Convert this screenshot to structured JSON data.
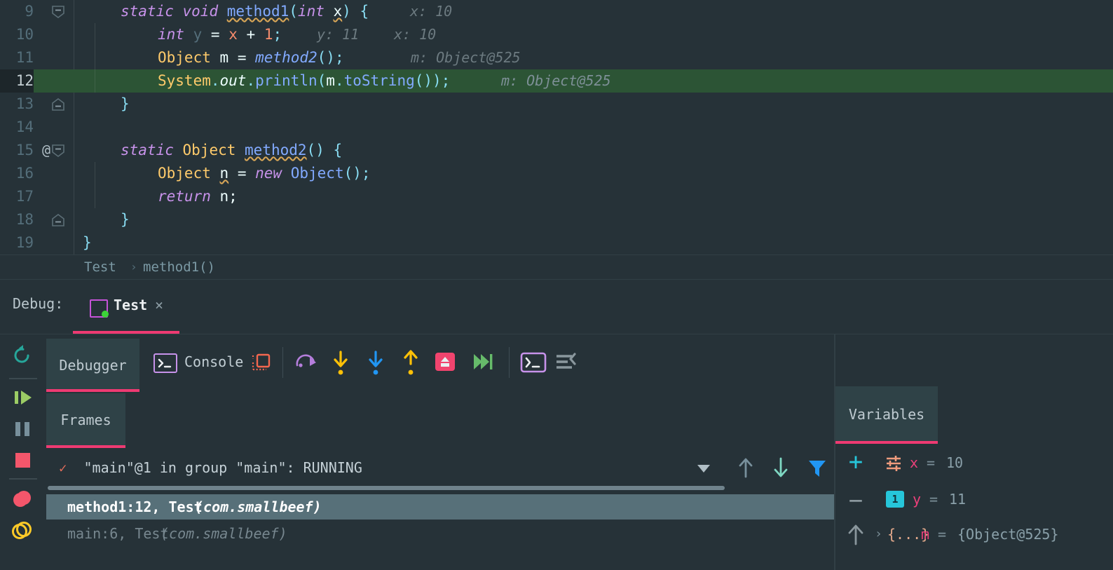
{
  "editor": {
    "lines": [
      {
        "num": "9",
        "at": "@?no",
        "fold": "open",
        "code": "static void method1(int x) {",
        "hint": "x: 10"
      },
      {
        "num": "10",
        "code": "int y = x + 1;",
        "hint": "y: 11   x: 10"
      },
      {
        "num": "11",
        "code": "Object m = method2();",
        "hint": "m: Object@525"
      },
      {
        "num": "12",
        "code": "System.out.println(m.toString());",
        "hint": "m: Object@525",
        "highlighted": true
      },
      {
        "num": "13",
        "code": "}",
        "fold": "close"
      },
      {
        "num": "14",
        "code": ""
      },
      {
        "num": "15",
        "code": "static Object method2() {",
        "fold": "open",
        "annotation": "@"
      },
      {
        "num": "16",
        "code": "Object n = new Object();"
      },
      {
        "num": "17",
        "code": "return n;"
      },
      {
        "num": "18",
        "code": "}",
        "fold": "close"
      },
      {
        "num": "19",
        "code": "}"
      }
    ],
    "tokens": {
      "l9": {
        "static": "static",
        "void": "void",
        "method1": "method1",
        "paren_open": "(",
        "int": "int",
        "x": "x",
        "paren_close": ")",
        "brace": "{"
      },
      "l10": {
        "int": "int",
        "y": "y",
        "eq": "=",
        "x": "x",
        "plus": "+",
        "one": "1",
        "semi": ";"
      },
      "l11": {
        "Object": "Object",
        "m": "m",
        "eq": "=",
        "method2": "method2",
        "call": "();"
      },
      "l12": {
        "System": "System",
        "out": "out",
        "println": "println",
        "m": "m",
        "toString": "toString"
      },
      "l15": {
        "static": "static",
        "Object": "Object",
        "method2": "method2",
        "call": "()",
        "brace": "{"
      },
      "l16": {
        "Object": "Object",
        "n": "n",
        "eq": "=",
        "new": "new",
        "call": "Object();"
      },
      "l17": {
        "return": "return",
        "n": "n;"
      }
    },
    "hints": {
      "l9": "x: 10",
      "l10a": "y: 11",
      "l10b": "x: 10",
      "l11": "m: Object@525",
      "l12": "m: Object@525"
    },
    "annotation_marker": "@"
  },
  "breadcrumb": {
    "items": [
      "Test",
      "method1()"
    ],
    "separator": "›"
  },
  "debug_header": {
    "label": "Debug:",
    "run_config_name": "Test",
    "close_label": "×"
  },
  "left_toolbar": {
    "items": [
      {
        "name": "rerun-icon",
        "title": "Rerun"
      },
      {
        "name": "resume-icon",
        "title": "Resume Program"
      },
      {
        "name": "pause-icon",
        "title": "Pause Program"
      },
      {
        "name": "stop-icon",
        "title": "Stop"
      },
      {
        "name": "view-breakpoints-icon",
        "title": "View Breakpoints"
      },
      {
        "name": "mute-breakpoints-icon",
        "title": "Mute Breakpoints"
      }
    ]
  },
  "debugger_panel": {
    "tabs": [
      {
        "label": "Debugger",
        "active": true
      },
      {
        "label": "Console",
        "active": false
      }
    ],
    "console_icon": "terminal-icon",
    "layout_icon": "layout-settings-icon",
    "step_buttons": [
      {
        "name": "show-execution-point-icon",
        "title": "Show Execution Point"
      },
      {
        "name": "step-over-icon",
        "title": "Step Over"
      },
      {
        "name": "step-into-icon",
        "title": "Step Into"
      },
      {
        "name": "step-out-icon",
        "title": "Step Out"
      },
      {
        "name": "drop-frame-icon",
        "title": "Drop Frame"
      },
      {
        "name": "run-to-cursor-icon",
        "title": "Run to Cursor"
      },
      {
        "name": "evaluate-expression-icon",
        "title": "Evaluate Expression"
      },
      {
        "name": "settings-icon",
        "title": "Settings"
      }
    ],
    "frames_tab": {
      "label": "Frames"
    },
    "thread": {
      "check": "✓",
      "text": "\"main\"@1 in group \"main\": RUNNING"
    },
    "frames_toolbar": [
      {
        "name": "thread-dropdown-icon",
        "title": "Select Thread"
      },
      {
        "name": "frame-up-icon",
        "title": "Up the Stack"
      },
      {
        "name": "frame-down-icon",
        "title": "Down the Stack"
      },
      {
        "name": "filter-frames-icon",
        "title": "Hide Frames from Libraries"
      }
    ],
    "frames": [
      {
        "method": "method1:12, Test ",
        "package": "(com.smallbeef)",
        "selected": true
      },
      {
        "method": "main:6, Test ",
        "package": "(com.smallbeef)",
        "selected": false
      }
    ]
  },
  "variables_panel": {
    "tab_label": "Variables",
    "toolbar": [
      {
        "name": "add-watch-icon",
        "label": "+",
        "title": "New Watch"
      },
      {
        "name": "remove-watch-icon",
        "label": "−",
        "title": "Remove Watch"
      },
      {
        "name": "watch-up-icon",
        "title": "Move Watch Up"
      }
    ],
    "rows": [
      {
        "icon": "local-variable-icon",
        "name": "x",
        "eq": "=",
        "value": "10",
        "expandable": false
      },
      {
        "icon": "primitive-badge-1",
        "badge": "1",
        "name": "y",
        "eq": "=",
        "value": "11",
        "expandable": false
      },
      {
        "icon": "object-braces-icon",
        "braces": "{...}",
        "chevron": "›",
        "name": "m",
        "eq": "=",
        "value": "{Object@525}",
        "expandable": true
      }
    ]
  },
  "colors": {
    "background": "#263238",
    "panel_tab": "#2f4247",
    "accent_pink": "#ee3a72",
    "exec_line_green": "#2c5435",
    "selected_frame": "#577079",
    "keyword_purple": "#c792ea",
    "type_yellow": "#ffcb6b",
    "method_blue": "#82aaff",
    "number_orange": "#f78c6c",
    "var_pink": "#ec407a",
    "cyan": "#26c6da",
    "green_resume": "#9ccc65"
  }
}
